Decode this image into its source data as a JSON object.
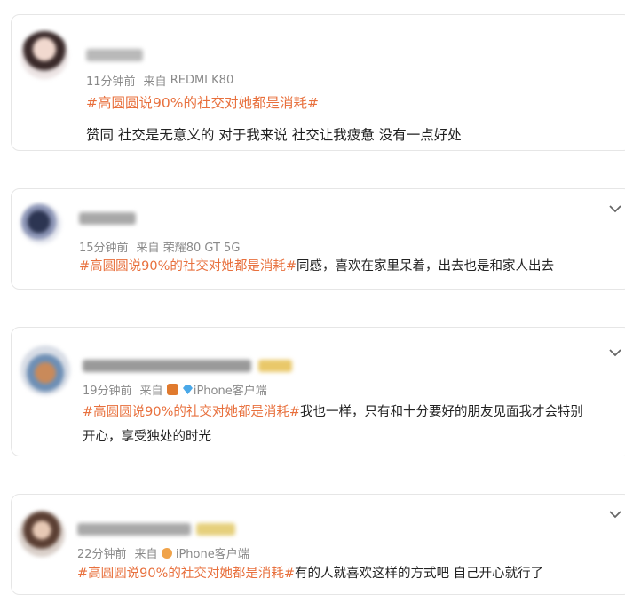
{
  "posts": [
    {
      "time": "11分钟前",
      "source_prefix": "来自",
      "source": "REDMI K80",
      "hashtag": "#高圆圆说90%的社交对她都是消耗#",
      "text": "赞同 社交是无意义的 对于我来说 社交让我疲惫 没有一点好处"
    },
    {
      "time": "15分钟前",
      "source_prefix": "来自",
      "source": "荣耀80 GT 5G",
      "hashtag": "#高圆圆说90%的社交对她都是消耗#",
      "text": "同感，喜欢在家里呆着，出去也是和家人出去"
    },
    {
      "time": "19分钟前",
      "source_prefix": "来自",
      "source": "iPhone客户端",
      "hashtag": "#高圆圆说90%的社交对她都是消耗#",
      "text_line1": "我也一样，只有和十分要好的朋友见面我才会特别",
      "text_line2": "开心，享受独处的时光"
    },
    {
      "time": "22分钟前",
      "source_prefix": "来自",
      "source": "iPhone客户端",
      "hashtag": "#高圆圆说90%的社交对她都是消耗#",
      "text": "有的人就喜欢这样的方式吧 自己开心就行了"
    }
  ],
  "colors": {
    "hashtag": "#e8703d",
    "meta": "#8a8a8a",
    "text": "#222222",
    "border": "#e6e6e6"
  },
  "icons": {
    "menu": "chevron-down-icon",
    "badge_fox": "fox-badge-icon",
    "badge_diamond": "diamond-badge-icon"
  }
}
